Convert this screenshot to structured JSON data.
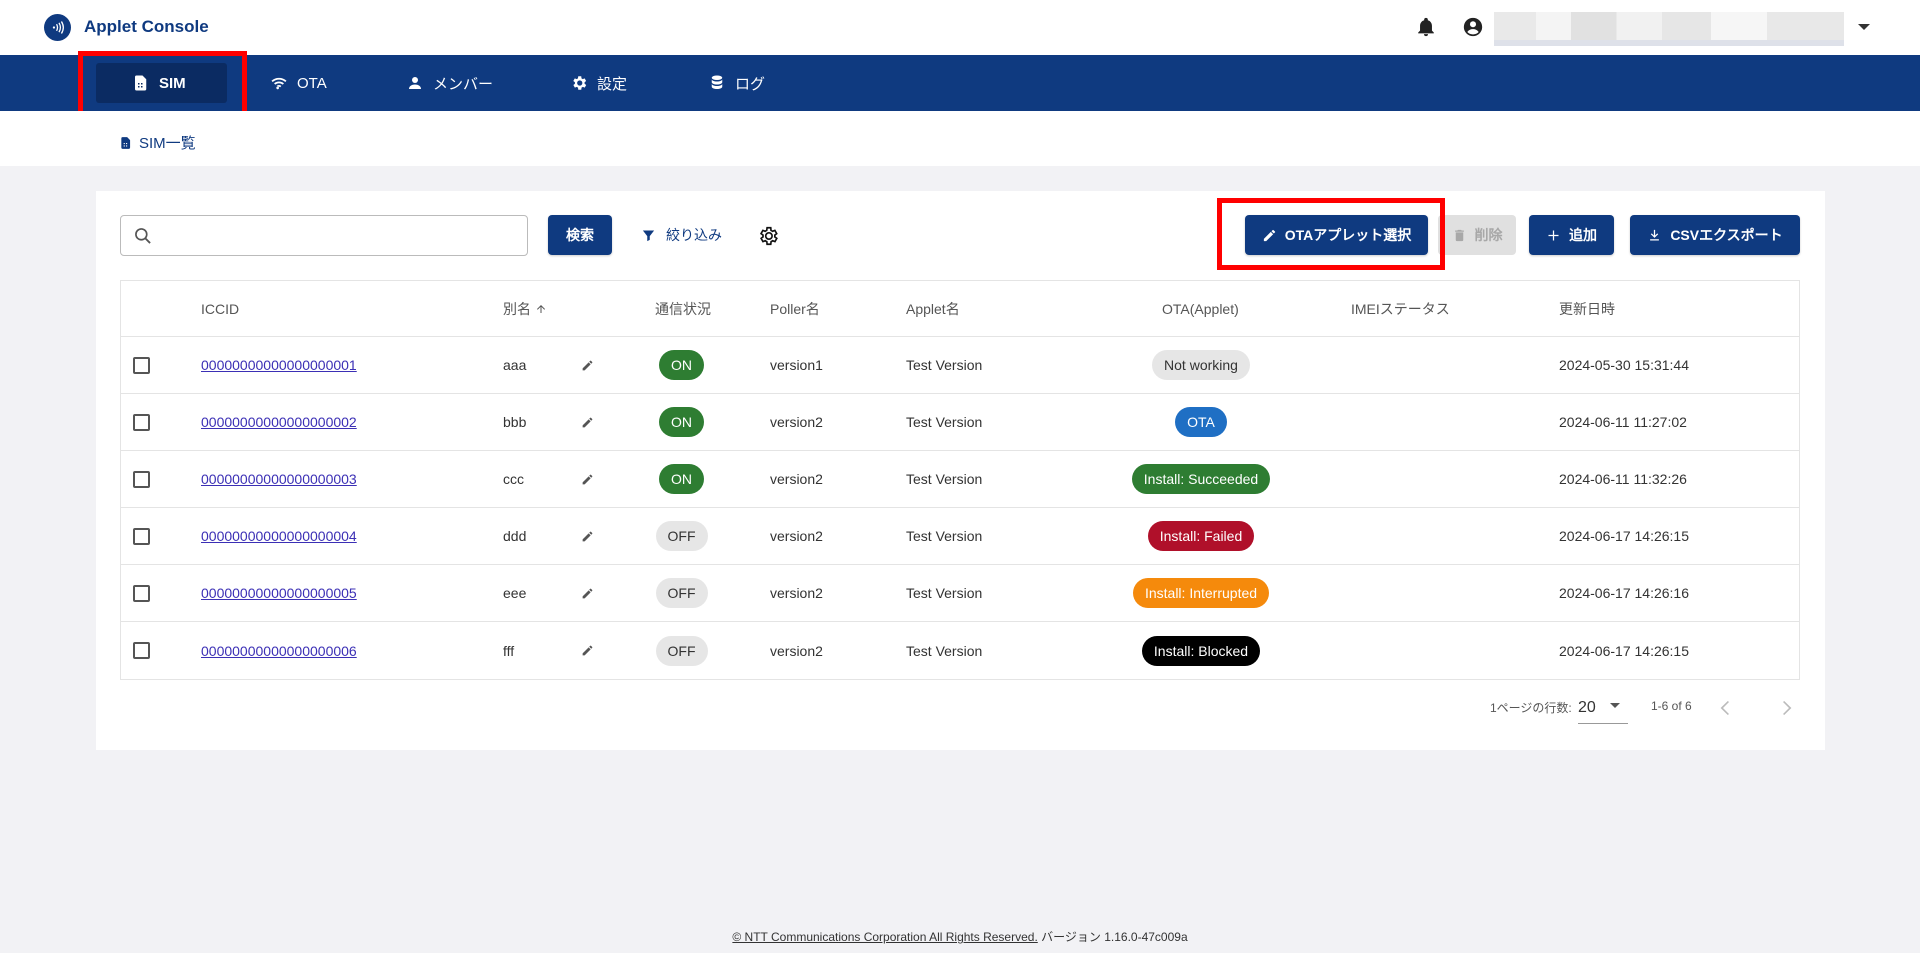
{
  "app": {
    "title": "Applet Console"
  },
  "nav": [
    {
      "label": "SIM",
      "icon": "sim-card-icon"
    },
    {
      "label": "OTA",
      "icon": "wifi-icon"
    },
    {
      "label": "メンバー",
      "icon": "person-icon"
    },
    {
      "label": "設定",
      "icon": "gear-icon"
    },
    {
      "label": "ログ",
      "icon": "database-icon"
    }
  ],
  "breadcrumb": {
    "label": "SIM一覧"
  },
  "toolbar": {
    "search_placeholder": "",
    "search_label": "検索",
    "filter_label": "絞り込み",
    "ota_select_label": "OTAアプレット選択",
    "delete_label": "削除",
    "add_label": "追加",
    "csv_label": "CSVエクスポート"
  },
  "table": {
    "headers": {
      "iccid": "ICCID",
      "alias": "別名",
      "comm": "通信状況",
      "poller": "Poller名",
      "applet": "Applet名",
      "ota": "OTA(Applet)",
      "imei": "IMEIステータス",
      "updated": "更新日時"
    },
    "rows": [
      {
        "iccid": "00000000000000000001",
        "alias": "aaa",
        "comm": "ON",
        "poller": "version1",
        "applet": "Test Version",
        "ota": "Not working",
        "updated": "2024-05-30 15:31:44"
      },
      {
        "iccid": "00000000000000000002",
        "alias": "bbb",
        "comm": "ON",
        "poller": "version2",
        "applet": "Test Version",
        "ota": "OTA",
        "updated": "2024-06-11 11:27:02"
      },
      {
        "iccid": "00000000000000000003",
        "alias": "ccc",
        "comm": "ON",
        "poller": "version2",
        "applet": "Test Version",
        "ota": "Install: Succeeded",
        "updated": "2024-06-11 11:32:26"
      },
      {
        "iccid": "00000000000000000004",
        "alias": "ddd",
        "comm": "OFF",
        "poller": "version2",
        "applet": "Test Version",
        "ota": "Install: Failed",
        "updated": "2024-06-17 14:26:15"
      },
      {
        "iccid": "00000000000000000005",
        "alias": "eee",
        "comm": "OFF",
        "poller": "version2",
        "applet": "Test Version",
        "ota": "Install: Interrupted",
        "updated": "2024-06-17 14:26:16"
      },
      {
        "iccid": "00000000000000000006",
        "alias": "fff",
        "comm": "OFF",
        "poller": "version2",
        "applet": "Test Version",
        "ota": "Install: Blocked",
        "updated": "2024-06-17 14:26:15"
      }
    ],
    "ota_colors": {
      "Not working": "#e6e6e6",
      "OTA": "#1f6fc4",
      "Install: Succeeded": "#2e7d32",
      "Install: Failed": "#b0102a",
      "Install: Interrupted": "#f58a0c",
      "Install: Blocked": "#000000"
    }
  },
  "pagination": {
    "rows_label": "1ページの行数:",
    "rows_value": "20",
    "range": "1-6 of 6"
  },
  "footer": {
    "copyright": "© NTT Communications Corporation All Rights Reserved.",
    "version": "バージョン 1.16.0-47c009a"
  }
}
